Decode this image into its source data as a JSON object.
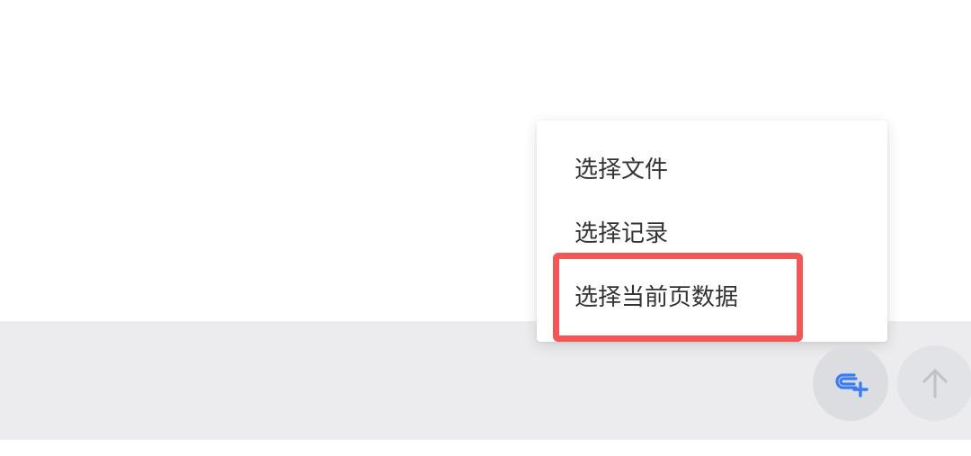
{
  "menu": {
    "items": [
      {
        "label": "选择文件"
      },
      {
        "label": "选择记录"
      },
      {
        "label": "选择当前页数据"
      }
    ]
  },
  "buttons": {
    "attach_icon": "attach-plus-icon",
    "send_icon": "arrow-up-icon"
  },
  "colors": {
    "input_bar_bg": "#ececee",
    "highlight": "#f25656",
    "attach_icon": "#3b7cf6",
    "send_icon": "#bfc1c6"
  }
}
